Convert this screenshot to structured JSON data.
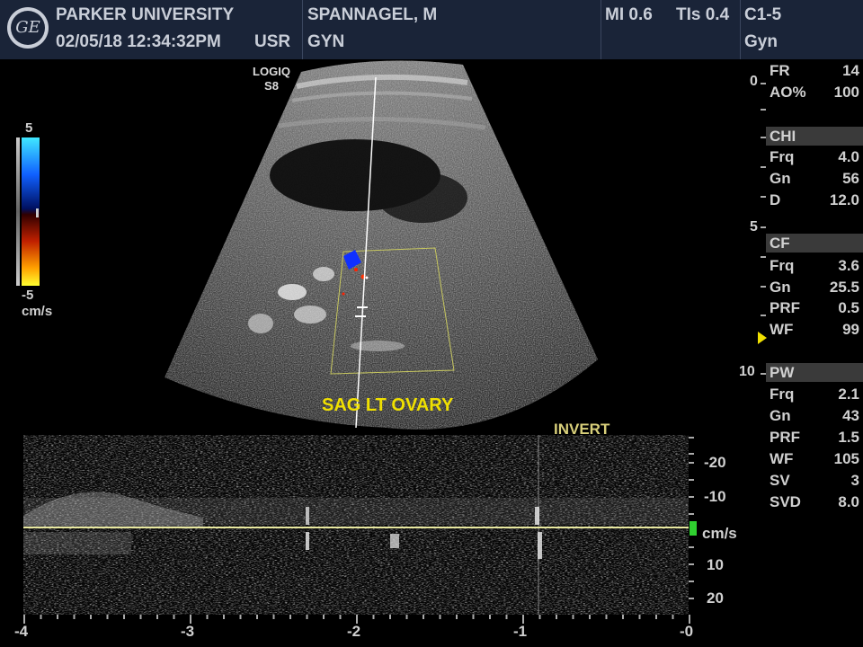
{
  "header": {
    "logo_text": "GE",
    "institution": "PARKER UNIVERSITY",
    "datetime": "02/05/18 12:34:32PM",
    "user": "USR",
    "patient": "SPANNAGEL, M",
    "exam": "GYN",
    "mi": "MI 0.6",
    "tis": "TIs 0.4",
    "probe": "C1-5",
    "preset": "Gyn"
  },
  "system": {
    "line1": "LOGIQ",
    "line2": "S8"
  },
  "color_scale": {
    "top": "5",
    "bottom": "-5",
    "unit": "cm/s"
  },
  "image": {
    "annotation": "SAG LT OVARY"
  },
  "depth_scale": [
    "0",
    "5",
    "10"
  ],
  "params": {
    "general": [
      {
        "label": "FR",
        "value": "14"
      },
      {
        "label": "AO%",
        "value": "100"
      }
    ],
    "chi": {
      "title": "CHI",
      "rows": [
        {
          "label": "Frq",
          "value": "4.0"
        },
        {
          "label": "Gn",
          "value": "56"
        },
        {
          "label": "D",
          "value": "12.0"
        }
      ]
    },
    "cf": {
      "title": "CF",
      "rows": [
        {
          "label": "Frq",
          "value": "3.6"
        },
        {
          "label": "Gn",
          "value": "25.5"
        },
        {
          "label": "PRF",
          "value": "0.5"
        },
        {
          "label": "WF",
          "value": "99"
        }
      ]
    },
    "pw": {
      "title": "PW",
      "rows": [
        {
          "label": "Frq",
          "value": "2.1"
        },
        {
          "label": "Gn",
          "value": "43"
        },
        {
          "label": "PRF",
          "value": "1.5"
        },
        {
          "label": "WF",
          "value": "105"
        },
        {
          "label": "SV",
          "value": "3"
        },
        {
          "label": "SVD",
          "value": "8.0"
        }
      ]
    }
  },
  "spectral": {
    "invert_label": "INVERT",
    "velocity_labels": [
      "-20",
      "-10",
      "cm/s",
      "10",
      "20"
    ],
    "time_labels": [
      "-4",
      "-3",
      "-2",
      "-1",
      "-0"
    ]
  },
  "colors": {
    "header_bg": "#1a2438",
    "annotation": "#f0e000",
    "baseline": "#e8e8a0"
  }
}
